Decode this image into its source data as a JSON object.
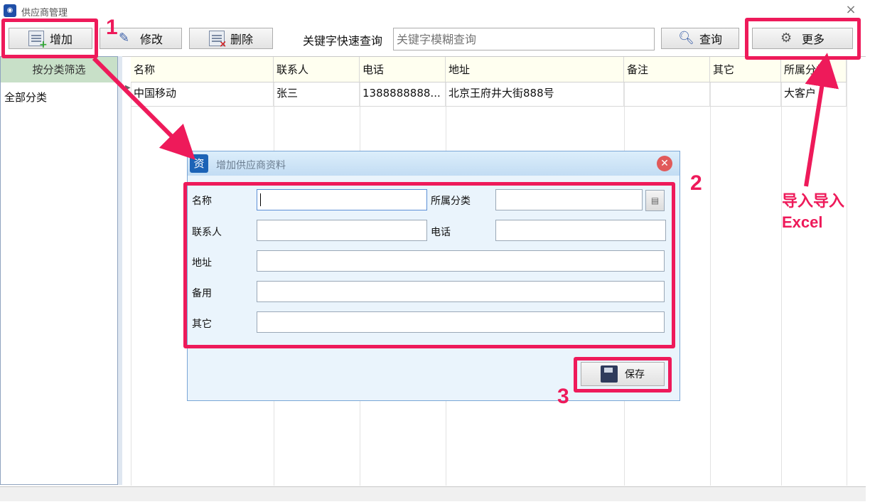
{
  "window": {
    "title": "供应商管理",
    "close_glyph": "×"
  },
  "toolbar": {
    "add": "增加",
    "edit": "修改",
    "delete": "删除",
    "keyword_label": "关键字快速查询",
    "search_placeholder": "关键字模糊查询",
    "query": "查询",
    "more": "更多"
  },
  "left_panel": {
    "header": "按分类筛选",
    "items": [
      "全部分类"
    ]
  },
  "grid": {
    "columns": [
      "名称",
      "联系人",
      "电话",
      "地址",
      "备注",
      "其它",
      "所属分类"
    ],
    "rows": [
      [
        "中国移动",
        "张三",
        "1388888888...",
        "北京王府井大街888号",
        "",
        "",
        "大客户"
      ]
    ]
  },
  "dialog": {
    "title": "增加供应商资料",
    "fields": {
      "name": "名称",
      "category": "所属分类",
      "contact": "联系人",
      "phone": "电话",
      "address": "地址",
      "spare": "备用",
      "other": "其它"
    },
    "save": "保存"
  },
  "annotations": {
    "steps": [
      "1",
      "2",
      "3"
    ],
    "note_line1": "导入导入",
    "note_line2": "Excel",
    "color": "#ee1a5a"
  }
}
